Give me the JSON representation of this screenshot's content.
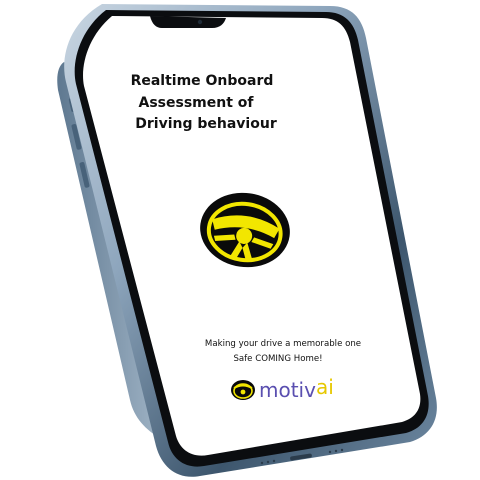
{
  "screen": {
    "headline_lines": [
      "Realtime Onboard",
      "Assessment of",
      "Driving behaviour"
    ],
    "tagline_lines": [
      "Making your drive a memorable one",
      "Safe COMING Home!"
    ],
    "brand": {
      "word1": "motiv",
      "word2": "ai"
    }
  },
  "colors": {
    "brand_black": "#0a0a0a",
    "brand_yellow": "#f2e600",
    "wordmark_purple": "#5a4fb0",
    "wordmark_yellow": "#e6c800",
    "frame_blue": "#8ea6bd",
    "frame_dark": "#30485e"
  },
  "icons": {
    "logo": "steering-wheel-logo-icon",
    "small_logo": "steering-wheel-small-icon"
  }
}
